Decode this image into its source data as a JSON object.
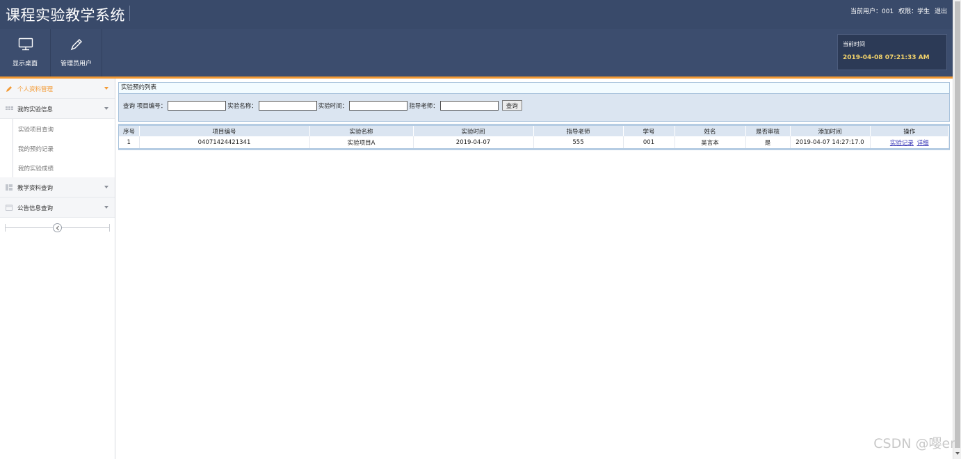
{
  "app": {
    "title": "课程实验教学系统"
  },
  "userbar": {
    "current_user": "当前用户：001",
    "role": "权限：学生",
    "logout": "退出"
  },
  "toolbar": {
    "desktop_label": "显示桌面",
    "admin_label": "管理员用户",
    "time_label": "当前时间",
    "time_value": "2019-04-08 07:21:33 AM"
  },
  "sidebar": {
    "groups": [
      {
        "label": "个人资料管理",
        "icon": "pencil-icon",
        "active": true
      },
      {
        "label": "我的实验信息",
        "icon": "grid-icon",
        "active": false,
        "items": [
          "实验项目查询",
          "我的预约记录",
          "我的实验成绩"
        ]
      },
      {
        "label": "教学资料查询",
        "icon": "layout-icon",
        "active": false
      },
      {
        "label": "公告信息查询",
        "icon": "calendar-icon",
        "active": false
      }
    ]
  },
  "main": {
    "panel_title": "实验预约列表",
    "search": {
      "prefix": "查询",
      "project_no_label": "项目编号：",
      "exp_name_label": "实验名称：",
      "exp_time_label": "实验时间：",
      "teacher_label": "指导老师：",
      "button": "查询"
    },
    "table": {
      "headers": [
        "序号",
        "项目编号",
        "实验名称",
        "实验时间",
        "指导老师",
        "学号",
        "姓名",
        "是否审核",
        "添加时间",
        "操作"
      ],
      "rows": [
        {
          "index": "1",
          "project_no": "04071424421341",
          "exp_name": "实验项目A",
          "exp_time": "2019-04-07",
          "teacher": "555",
          "student_no": "001",
          "name": "吴言本",
          "audited": "是",
          "added_time": "2019-04-07 14:27:17.0",
          "action_record": "实验记录",
          "action_detail": "详细"
        }
      ]
    }
  },
  "watermark": "CSDN @嘤er",
  "colors": {
    "header_bg": "#394a6a",
    "accent_orange": "#f39a34",
    "time_text": "#f3d36b"
  }
}
